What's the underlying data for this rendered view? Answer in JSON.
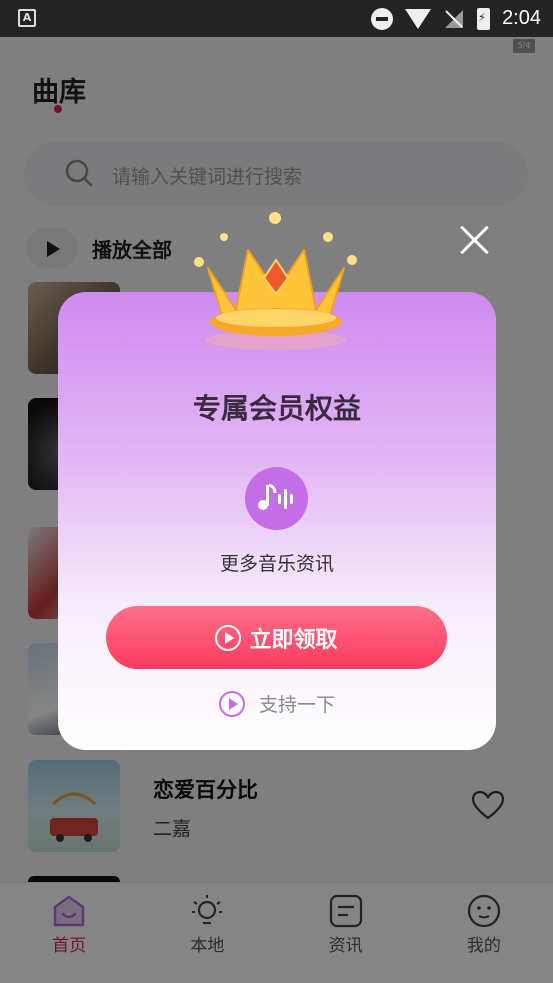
{
  "status_bar": {
    "time": "2:04",
    "app_icon": "A"
  },
  "page": {
    "title": "曲库",
    "corner_badge": "5/4"
  },
  "search": {
    "placeholder": "请输入关键词进行搜索"
  },
  "play_all": {
    "label": "播放全部"
  },
  "songs": [
    {
      "name": "",
      "artist": ""
    },
    {
      "name": "",
      "artist": ""
    },
    {
      "name": "",
      "artist": ""
    },
    {
      "name": "",
      "artist": ""
    },
    {
      "name": "恋爱百分比",
      "artist": "二嘉"
    }
  ],
  "bottom_nav": [
    {
      "label": "首页",
      "icon": "home-icon",
      "active": true
    },
    {
      "label": "本地",
      "icon": "lightbulb-icon",
      "active": false
    },
    {
      "label": "资讯",
      "icon": "news-icon",
      "active": false
    },
    {
      "label": "我的",
      "icon": "profile-icon",
      "active": false
    }
  ],
  "modal": {
    "title": "专属会员权益",
    "benefit": {
      "label": "更多音乐资讯",
      "icon": "music-wave-icon"
    },
    "claim_button": "立即领取",
    "support_link": "支持一下",
    "colors": {
      "accent": "#fb3a5f",
      "purple": "#c36ee6"
    }
  }
}
